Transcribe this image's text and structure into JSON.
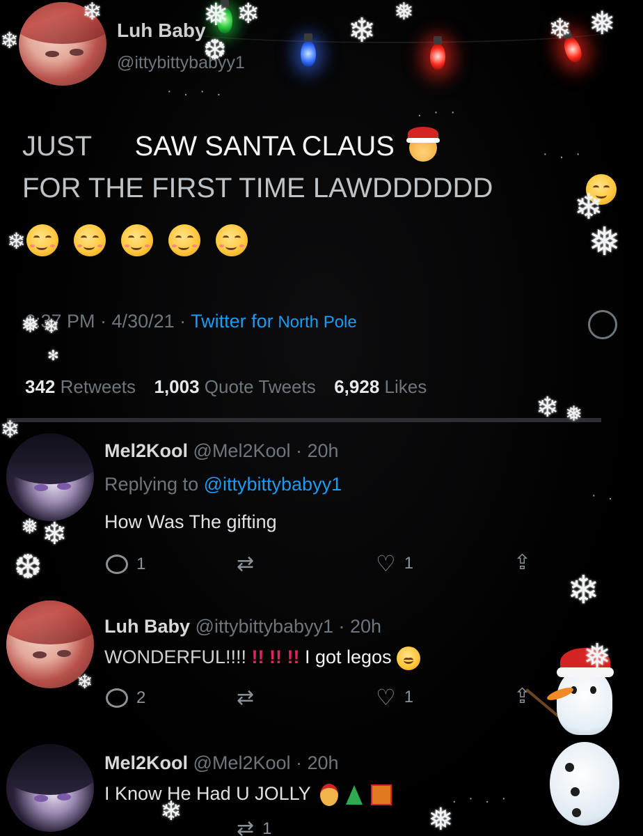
{
  "original_tweet": {
    "display_name": "Luh Baby",
    "handle": "@ittybittybabyy1",
    "text_line1_a": "JUST",
    "text_line1_b": "SAW SANTA CLAUS",
    "text_line2": "FOR THE FIRST TIME LAWDDDDDD",
    "time": "6:37 PM · 4/30/21 · ",
    "source_prefix": "Twitter for",
    "source_suffix": " North Pole",
    "stats": {
      "retweets_count": "342",
      "retweets_label": "Retweets",
      "quotes_count": "1,003",
      "quotes_label": "Quote Tweets",
      "likes_count": "6,928",
      "likes_label": "Likes"
    }
  },
  "replies": [
    {
      "display_name": "Mel2Kool",
      "handle_time": "@Mel2Kool · 20h",
      "replying_prefix": "Replying to ",
      "replying_handle": "@ittybittybabyy1",
      "text": "How Was The gifting",
      "reply_count": "1",
      "retweet_count": "",
      "like_count": "1"
    },
    {
      "display_name": "Luh Baby",
      "handle_time": "@ittybittybabyy1 · 20h",
      "text": "WONDERFUL!!!! ",
      "exclaims": "!! !! !!",
      "text_tail": " I got legos",
      "reply_count": "2",
      "retweet_count": "",
      "like_count": "1"
    },
    {
      "display_name": "Mel2Kool",
      "handle_time": "@Mel2Kool · 20h",
      "text": "I Know He Had U JOLLY",
      "reply_count": "",
      "retweet_count": "1",
      "like_count": ""
    }
  ],
  "icons": {
    "reply": "speech-bubble-icon",
    "retweet": "retweet-arrows-icon",
    "like": "heart-icon",
    "share": "share-upload-icon"
  },
  "colors": {
    "background": "#000000",
    "link_blue": "#1d9bf0",
    "muted": "#6e767d",
    "red_exclaim": "#e0245e"
  }
}
